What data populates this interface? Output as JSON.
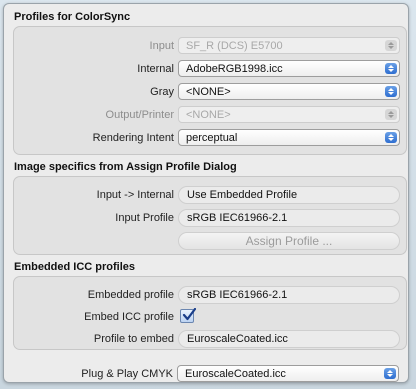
{
  "colorsync": {
    "title": "Profiles for ColorSync",
    "input_label": "Input",
    "input_value": "SF_R (DCS) E5700",
    "internal_label": "Internal",
    "internal_value": "AdobeRGB1998.icc",
    "gray_label": "Gray",
    "gray_value": "<NONE>",
    "output_label": "Output/Printer",
    "output_value": "<NONE>",
    "intent_label": "Rendering Intent",
    "intent_value": "perceptual"
  },
  "assign": {
    "title": "Image specifics from Assign Profile Dialog",
    "input_internal_label": "Input -> Internal",
    "input_internal_value": "Use Embedded Profile",
    "input_profile_label": "Input Profile",
    "input_profile_value": "sRGB IEC61966-2.1",
    "button_label": "Assign Profile ..."
  },
  "embedded": {
    "title": "Embedded ICC profiles",
    "embedded_label": "Embedded profile",
    "embedded_value": "sRGB IEC61966-2.1",
    "embed_label": "Embed ICC profile",
    "embed_checked": true,
    "to_embed_label": "Profile to embed",
    "to_embed_value": "EuroscaleCoated.icc"
  },
  "plug_play": {
    "label": "Plug & Play CMYK",
    "value": "EuroscaleCoated.icc"
  },
  "colors": {
    "accent": "#3a7ad8",
    "panel": "#ececec",
    "group": "#e2e2e2"
  },
  "icons": {
    "popup_arrows": "updown-arrows-icon",
    "checkmark": "checkmark-icon"
  }
}
